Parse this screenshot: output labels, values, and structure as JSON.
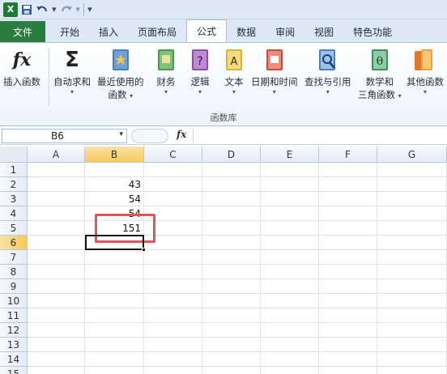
{
  "qat": {
    "undo_icon": "undo-icon",
    "redo_icon": "redo-icon",
    "save_icon": "save-icon"
  },
  "tabs": [
    {
      "label": "文件"
    },
    {
      "label": "开始"
    },
    {
      "label": "插入"
    },
    {
      "label": "页面布局"
    },
    {
      "label": "公式"
    },
    {
      "label": "数据"
    },
    {
      "label": "审阅"
    },
    {
      "label": "视图"
    },
    {
      "label": "特色功能"
    }
  ],
  "ribbon": {
    "insert_function": "插入函数",
    "autosum": "自动求和",
    "recent": [
      "最近使用的",
      "函数"
    ],
    "financial": "财务",
    "logical": "逻辑",
    "text": "文本",
    "datetime": "日期和时间",
    "lookup": "查找与引用",
    "math": [
      "数学和",
      "三角函数"
    ],
    "more": "其他函数",
    "group_label": "函数库"
  },
  "formula_bar": {
    "name_box": "B6",
    "fx_label": "fx",
    "formula": ""
  },
  "grid": {
    "columns": [
      "A",
      "B",
      "C",
      "D",
      "E",
      "F",
      "G"
    ],
    "rows": [
      "1",
      "2",
      "3",
      "4",
      "5",
      "6",
      "7",
      "8",
      "9",
      "10",
      "11",
      "12",
      "13",
      "14",
      "15"
    ],
    "cells": {
      "B2": "43",
      "B3": "54",
      "B4": "54",
      "B5": "151"
    },
    "selected_cell": "B6"
  },
  "colors": {
    "file_tab": "#2a7d3f",
    "highlight": "#e05656",
    "header_sel": "#f6c95c"
  }
}
